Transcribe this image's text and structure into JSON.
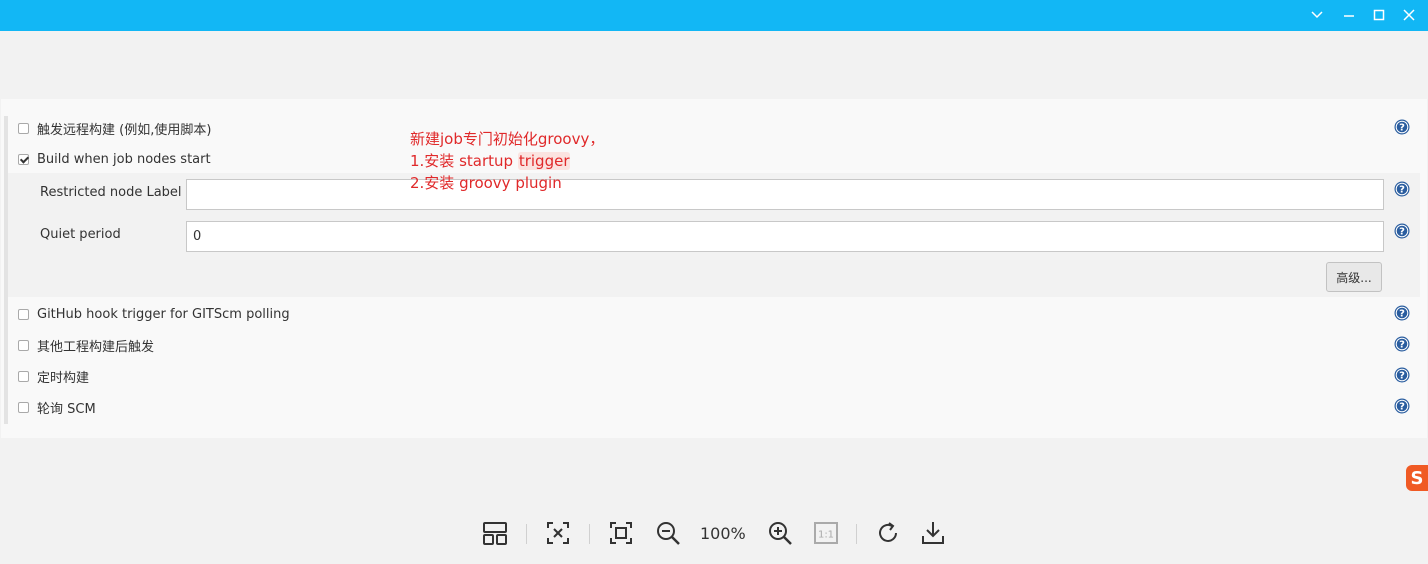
{
  "window": {
    "titlebar_color": "#12b7f5",
    "controls": [
      "chevron-down-icon",
      "minimize-icon",
      "maximize-icon",
      "close-icon"
    ]
  },
  "triggers": {
    "remote_build": {
      "label": "触发远程构建 (例如,使用脚本)",
      "checked": false
    },
    "build_when_nodes_start": {
      "label": "Build when job nodes start",
      "checked": true
    },
    "restricted_node_label": {
      "label": "Restricted node Label",
      "value": ""
    },
    "quiet_period": {
      "label": "Quiet period",
      "value": "0"
    },
    "advanced_button": "高级...",
    "github_hook": {
      "label": "GitHub hook trigger for GITScm polling",
      "checked": false
    },
    "after_other_projects": {
      "label": "其他工程构建后触发",
      "checked": false
    },
    "periodic_build": {
      "label": "定时构建",
      "checked": false
    },
    "poll_scm": {
      "label": "轮询 SCM",
      "checked": false
    }
  },
  "annotation": {
    "line1": "新建job专门初始化groovy，",
    "line2_prefix": "1.安装 startup ",
    "line2_highlight": "trigger",
    "line3": "2.安装 groovy plugin",
    "color": "#e0292a"
  },
  "viewer_toolbar": {
    "zoom_label": "100%",
    "icons": [
      "layout-icon",
      "fit-close-icon",
      "fit-window-icon",
      "zoom-out-icon",
      "zoom-in-icon",
      "actual-size-icon",
      "rotate-icon",
      "download-icon"
    ],
    "actual_size_label": "1:1"
  },
  "ime_badge": "S"
}
